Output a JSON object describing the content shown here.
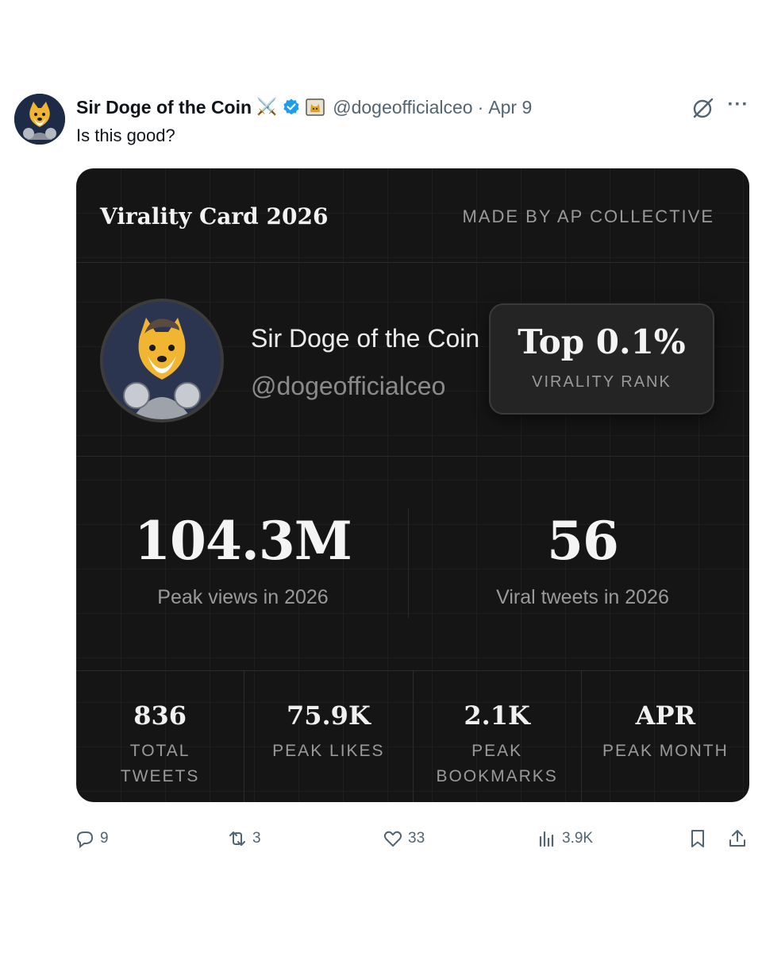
{
  "tweet": {
    "author_name": "Sir Doge of the Coin",
    "handle": "@dogeofficialceo",
    "separator": "·",
    "date": "Apr 9",
    "text": "Is this good?",
    "swords_emoji": "⚔️",
    "more_icon": "···"
  },
  "card": {
    "title": "Virality Card 2026",
    "credit": "MADE BY AP COLLECTIVE",
    "profile_name": "Sir Doge of the Coin",
    "profile_handle": "@dogeofficialceo",
    "rank_value": "Top 0.1%",
    "rank_label": "VIRALITY RANK",
    "big_stats": [
      {
        "value": "104.3M",
        "label": "Peak views in 2026"
      },
      {
        "value": "56",
        "label": "Viral tweets in 2026"
      }
    ],
    "small_stats": [
      {
        "value": "836",
        "label": "TOTAL TWEETS"
      },
      {
        "value": "75.9K",
        "label": "PEAK LIKES"
      },
      {
        "value": "2.1K",
        "label": "PEAK BOOKMARKS"
      },
      {
        "value": "APR",
        "label": "PEAK MONTH"
      }
    ]
  },
  "actions": {
    "replies": "9",
    "retweets": "3",
    "likes": "33",
    "views": "3.9K"
  },
  "icons": {
    "avatar": "doge-knight-avatar",
    "verified": "verified-badge-icon",
    "grok": "grok-icon",
    "reply": "reply-icon",
    "retweet": "retweet-icon",
    "like": "heart-icon",
    "views": "views-icon",
    "bookmark": "bookmark-icon",
    "share": "share-icon"
  },
  "colors": {
    "verified_blue": "#1d9bf0",
    "card_bg": "#151515",
    "muted_text": "#536471"
  }
}
